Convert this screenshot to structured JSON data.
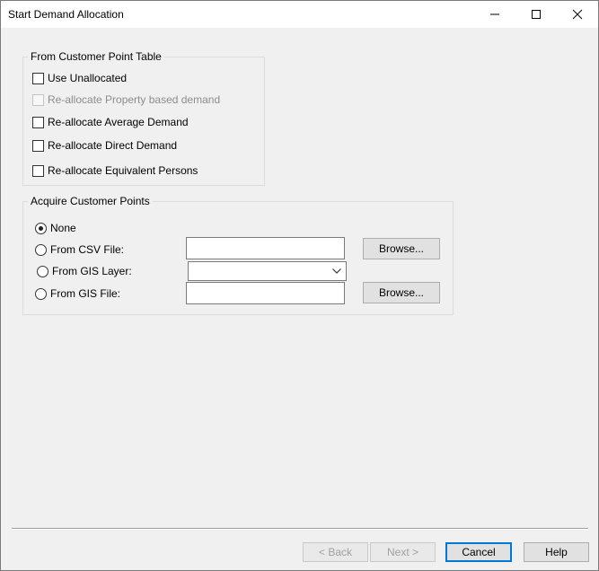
{
  "window": {
    "title": "Start Demand Allocation"
  },
  "customer_table": {
    "legend": "From Customer Point Table",
    "options": [
      {
        "label": "Use Unallocated",
        "checked": false,
        "enabled": true
      },
      {
        "label": "Re-allocate Property based demand",
        "checked": false,
        "enabled": false
      },
      {
        "label": "Re-allocate Average Demand",
        "checked": false,
        "enabled": true
      },
      {
        "label": "Re-allocate Direct Demand",
        "checked": false,
        "enabled": true
      },
      {
        "label": "Re-allocate Equivalent Persons",
        "checked": false,
        "enabled": true
      }
    ]
  },
  "acquire": {
    "legend": "Acquire Customer Points",
    "none_label": "None",
    "csv_label": "From CSV File:",
    "csv_value": "",
    "gis_layer_label": "From GIS Layer:",
    "gis_layer_value": "",
    "gis_file_label": "From GIS File:",
    "gis_file_value": "",
    "browse_label": "Browse...",
    "selected": "None"
  },
  "buttons": {
    "back": "< Back",
    "next": "Next >",
    "cancel": "Cancel",
    "help": "Help"
  },
  "colors": {
    "accent": "#0078d7",
    "background": "#f0f0f0"
  }
}
